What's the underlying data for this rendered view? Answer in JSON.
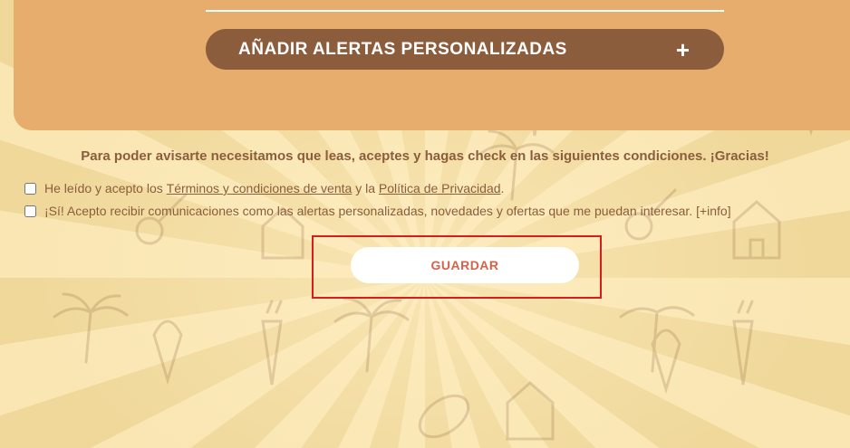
{
  "alerts_section": {
    "add_alerts_label": "AÑADIR ALERTAS PERSONALIZADAS",
    "expand_symbol": "+"
  },
  "consent": {
    "notice": "Para poder avisarte necesitamos que leas, aceptes y hagas check en las siguientes condiciones. ¡Gracias!",
    "terms_prefix": "He leído y acepto los",
    "terms_link": "Términos y condiciones de venta",
    "terms_connector": "y la",
    "privacy_link": "Política de Privacidad",
    "terms_suffix": ".",
    "marketing_text": "¡Sí! Acepto recibir comunicaciones como las alertas personalizadas, novedades y ofertas que me puedan interesar.",
    "more_info_link": "[+info]",
    "terms_checked": false,
    "marketing_checked": false
  },
  "actions": {
    "save_label": "GUARDAR"
  },
  "colors": {
    "background": "#f3dfa6",
    "panel": "#e7ad6c",
    "brown": "#8b5d3c",
    "save_text": "#d6624a",
    "highlight": "#d81c1c"
  }
}
